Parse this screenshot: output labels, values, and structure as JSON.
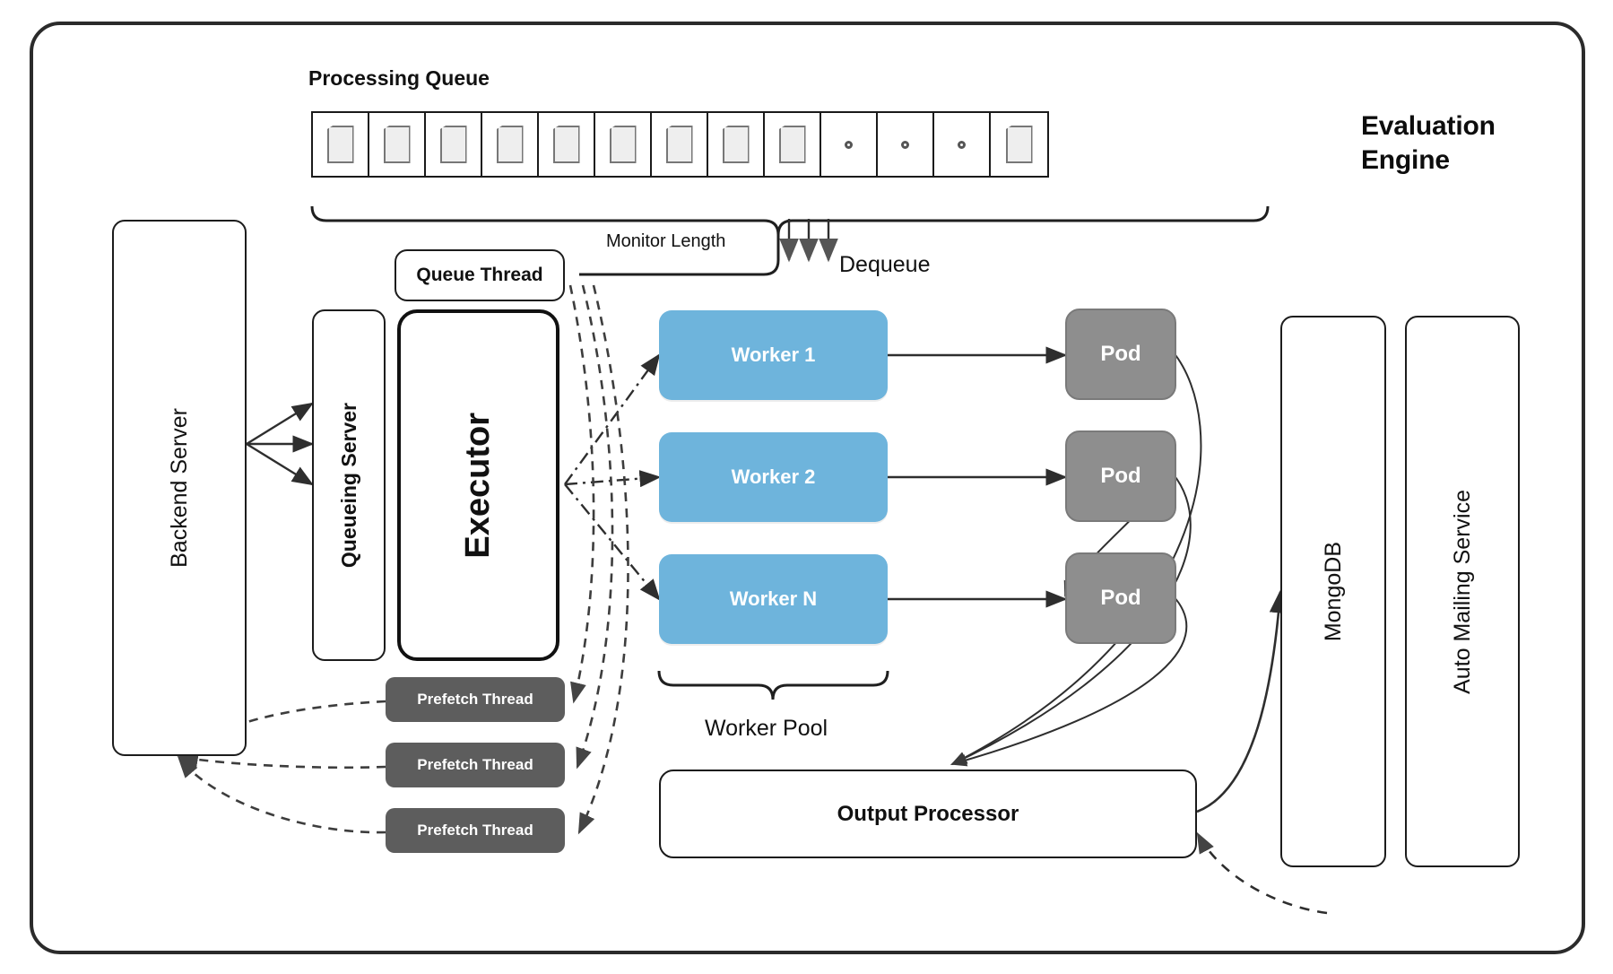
{
  "diagram": {
    "title": "Evaluation Engine",
    "frame_label": "evaluation-engine-frame"
  },
  "queue": {
    "title": "Processing Queue",
    "cells": [
      {
        "type": "document"
      },
      {
        "type": "document"
      },
      {
        "type": "document"
      },
      {
        "type": "document"
      },
      {
        "type": "document"
      },
      {
        "type": "document"
      },
      {
        "type": "document"
      },
      {
        "type": "document"
      },
      {
        "type": "document"
      },
      {
        "type": "dot"
      },
      {
        "type": "dot"
      },
      {
        "type": "dot"
      },
      {
        "type": "document"
      }
    ],
    "document_count": 10,
    "dot_count": 3
  },
  "nodes": {
    "backend_server": "Backend Server",
    "queueing_server": "Queueing Server",
    "executor": "Executor",
    "queue_thread": "Queue Thread",
    "output_processor": "Output Processor",
    "mongodb": "MongoDB",
    "auto_mailing_service": "Auto Mailing Service"
  },
  "workers": [
    {
      "label": "Worker 1"
    },
    {
      "label": "Worker 2"
    },
    {
      "label": "Worker N"
    }
  ],
  "pods": [
    {
      "label": "Pod"
    },
    {
      "label": "Pod"
    },
    {
      "label": "Pod"
    }
  ],
  "prefetch_threads": [
    {
      "label": "Prefetch Thread"
    },
    {
      "label": "Prefetch Thread"
    },
    {
      "label": "Prefetch Thread"
    }
  ],
  "edge_labels": {
    "monitor_length": "Monitor Length",
    "dequeue": "Dequeue",
    "worker_pool": "Worker Pool"
  },
  "colors": {
    "worker_fill": "#6eb4dc",
    "pod_fill": "#8e8e8e",
    "prefetch_fill": "#5d5d5d",
    "frame_stroke": "#2b2b2b",
    "box_stroke": "#1a1a1a",
    "document_fill": "#eeeeee",
    "text": "#111111"
  }
}
